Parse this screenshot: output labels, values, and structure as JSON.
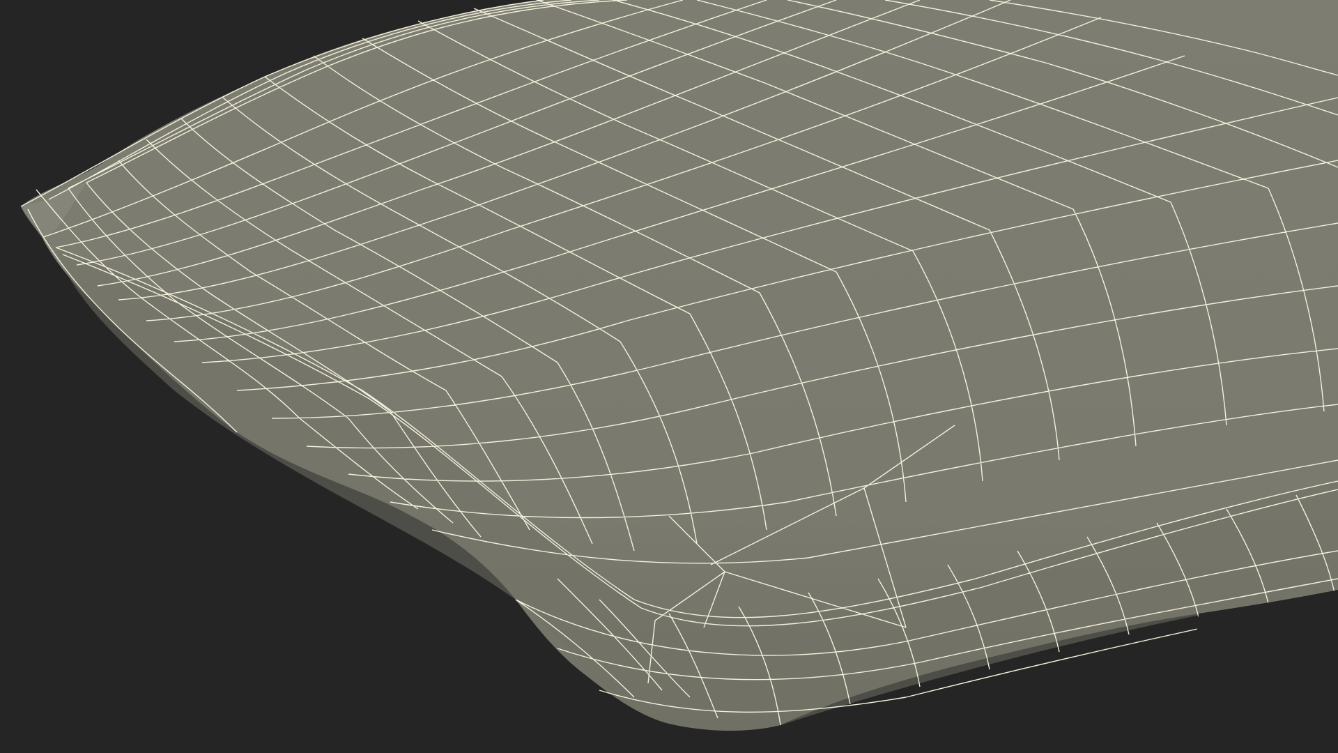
{
  "scene": {
    "subject": "wireframe-pillow-model",
    "colors": {
      "background": "#252525",
      "surface": "#7a7a6e",
      "surface_shadow": "#6c6c61",
      "surface_highlight": "#858579",
      "wire": "#f4f1dc"
    }
  }
}
